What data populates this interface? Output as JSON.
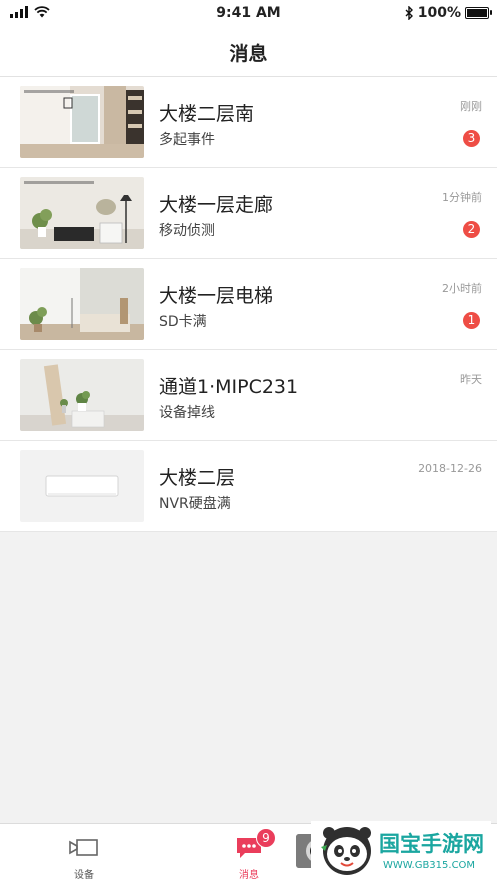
{
  "status_bar": {
    "time": "9:41 AM",
    "battery": "100%"
  },
  "header": {
    "title": "消息"
  },
  "messages": [
    {
      "name": "大楼二层南",
      "event": "多起事件",
      "time": "刚刚",
      "badge": "3"
    },
    {
      "name": "大楼一层走廊",
      "event": "移动侦测",
      "time": "1分钟前",
      "badge": "2"
    },
    {
      "name": "大楼一层电梯",
      "event": "SD卡满",
      "time": "2小时前",
      "badge": "1"
    },
    {
      "name": "通道1·MIPC231",
      "event": "设备掉线",
      "time": "昨天",
      "badge": ""
    },
    {
      "name": "大楼二层",
      "event": "NVR硬盘满",
      "time": "2018-12-26",
      "badge": ""
    }
  ],
  "tabbar": {
    "devices_label": "设备",
    "messages_label": "消息",
    "messages_badge": "9"
  },
  "watermark": {
    "brand": "国宝手游网",
    "url": "WWW.GB315.COM"
  },
  "colors": {
    "accent": "#ea3d5b",
    "badge_red": "#ee4d45"
  }
}
